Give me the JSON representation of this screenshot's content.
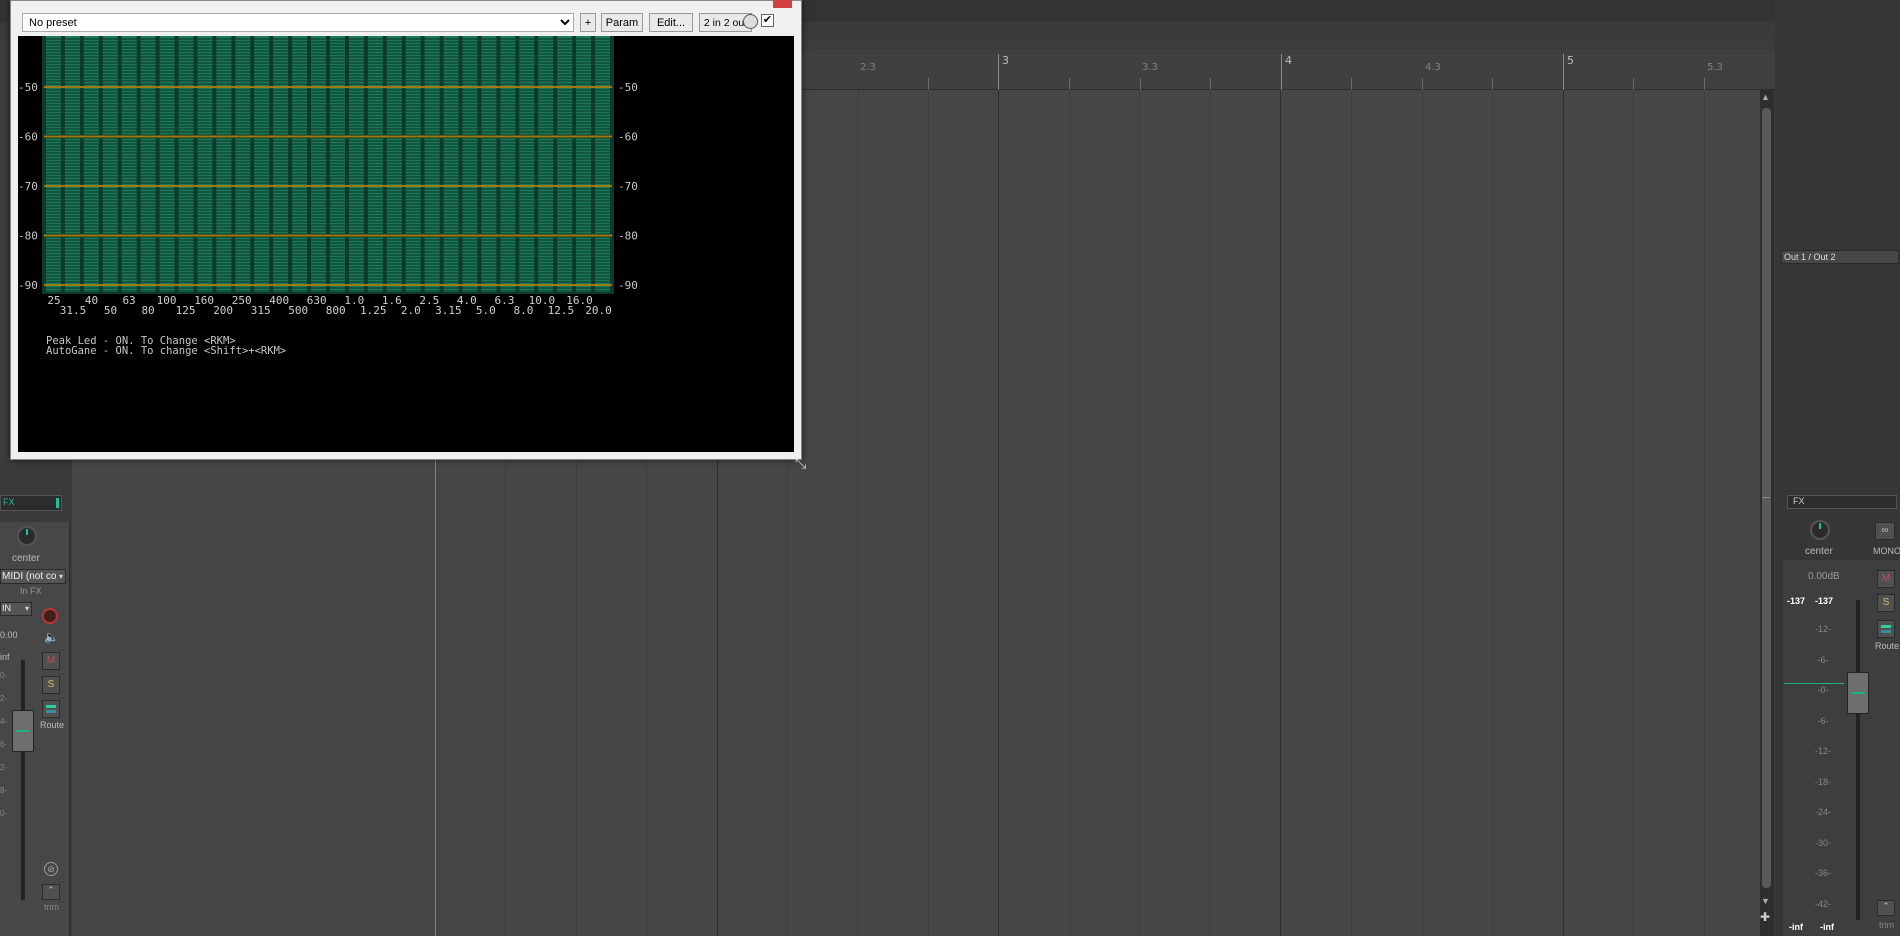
{
  "plugin": {
    "preset_value": "No preset",
    "add_label": "+",
    "param_label": "Param",
    "edit_label": "Edit...",
    "io_label": "2 in 2 out",
    "bypass_checked": "✔",
    "y_labels": [
      "-50",
      "-60",
      "-70",
      "-80",
      "-90"
    ],
    "freq_row1": [
      "25",
      "40",
      "63",
      "100",
      "160",
      "250",
      "400",
      "630",
      "1.0",
      "1.6",
      "2.5",
      "4.0",
      "6.3",
      "10.0",
      "16.0"
    ],
    "freq_row2": [
      "31.5",
      "50",
      "80",
      "125",
      "200",
      "315",
      "500",
      "800",
      "1.25",
      "2.0",
      "3.15",
      "5.0",
      "8.0",
      "12.5",
      "20.0"
    ],
    "info_line1": "Peak Led - ON.  To Change <RKM>",
    "info_line2": "AutoGane - ON.  To change <Shift>+<RKM>",
    "bar_color": "#1a7a5a",
    "grid_color": "#a07a10"
  },
  "ruler": {
    "labels": [
      "2.3",
      "3",
      "3.3",
      "4",
      "4.3",
      "5",
      "5.3"
    ]
  },
  "left_track": {
    "fx_label": "FX",
    "pan_label": "center",
    "midi_label": "MIDI (not co",
    "infx_label": "In FX",
    "in_label": "IN",
    "volume_value": "0.00",
    "inf_label": "inf",
    "m_label": "M",
    "s_label": "S",
    "route_label": "Route",
    "trim_label": "trim",
    "scale": [
      "0-",
      "2-",
      "4-",
      "6-",
      "2-",
      "8-",
      "0-"
    ]
  },
  "master": {
    "output_label": "Out 1 / Out 2",
    "fx_label": "FX",
    "pan_label": "center",
    "mono_label": "MONO",
    "volume_db": "0.00dB",
    "peak_left": "-137",
    "peak_right": "-137",
    "m_label": "M",
    "s_label": "S",
    "route_label": "Route",
    "trim_label": "trim",
    "scale": [
      "-12-",
      "-6-",
      "-0-",
      "-6-",
      "-12-",
      "-18-",
      "-24-",
      "-30-",
      "-36-",
      "-42-"
    ],
    "bottom_left": "-inf",
    "bottom_right": "-inf"
  }
}
